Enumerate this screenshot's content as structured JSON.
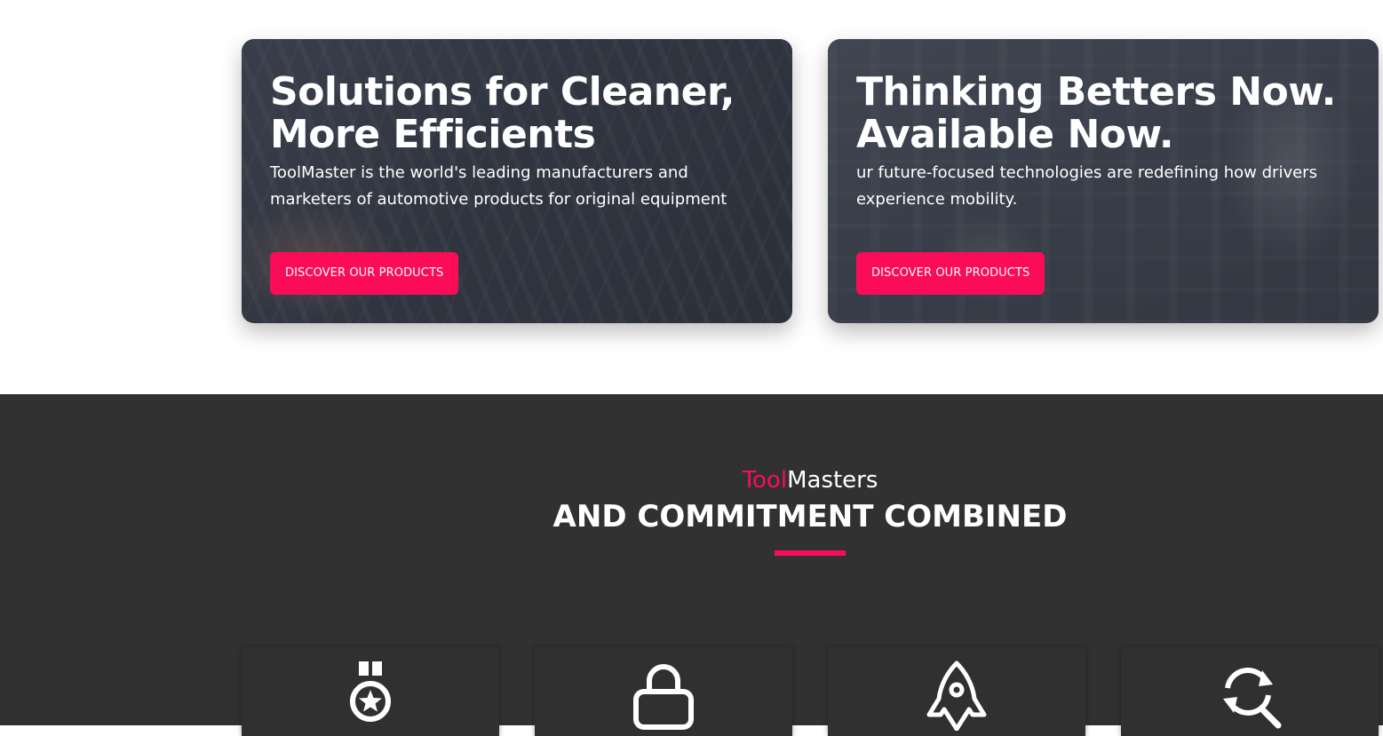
{
  "cards": [
    {
      "title": "Solutions for Cleaner,\nMore Efficients",
      "text": "ToolMaster is the world's leading manufacturers and marketers of automotive products for original equipment",
      "button_label": "Discover our products"
    },
    {
      "title": "Thinking Betters Now.\nAvailable Now.",
      "text": "ur future-focused technologies are redefining how drivers experience mobility.",
      "button_label": "Discover our products"
    }
  ],
  "section": {
    "subtitle_accent": "Tool",
    "subtitle_rest": "Masters",
    "title": "AND COMMITMENT COMBINED"
  },
  "features": [
    {
      "icon": "medal-icon"
    },
    {
      "icon": "lock-icon"
    },
    {
      "icon": "rocket-icon"
    },
    {
      "icon": "search-refresh-icon"
    }
  ],
  "colors": {
    "accent": "#fb0c58",
    "dark_background": "#313131",
    "text_light": "#ffffff"
  }
}
